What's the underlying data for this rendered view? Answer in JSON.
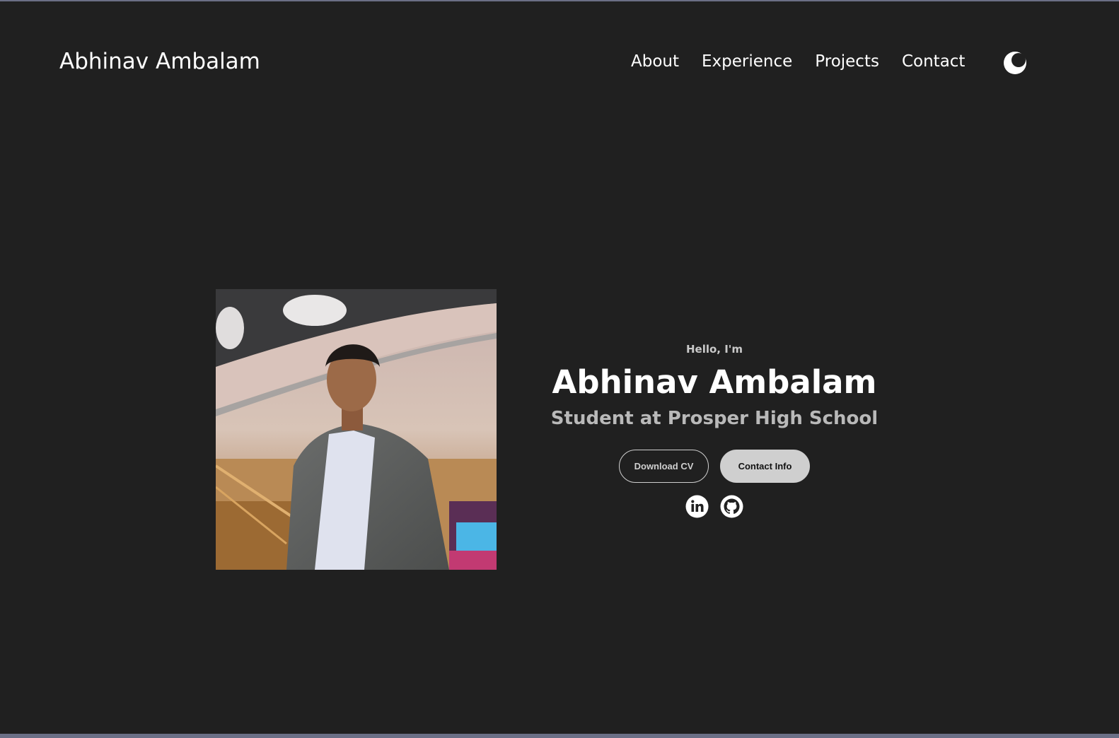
{
  "header": {
    "logo": "Abhinav Ambalam",
    "nav": [
      {
        "label": "About"
      },
      {
        "label": "Experience"
      },
      {
        "label": "Projects"
      },
      {
        "label": "Contact"
      }
    ],
    "theme_toggle_icon": "moon-icon"
  },
  "hero": {
    "photo_alt": "Profile picture",
    "greeting": "Hello, I'm",
    "name": "Abhinav Ambalam",
    "subtitle": "Student at Prosper High School",
    "buttons": {
      "download_cv": "Download CV",
      "contact_info": "Contact Info"
    },
    "socials": [
      {
        "icon": "linkedin-icon"
      },
      {
        "icon": "github-icon"
      }
    ]
  },
  "colors": {
    "background": "#202020",
    "text": "#ffffff",
    "subtitle": "#b9b9b9",
    "button_fill": "#cfcfcf"
  }
}
